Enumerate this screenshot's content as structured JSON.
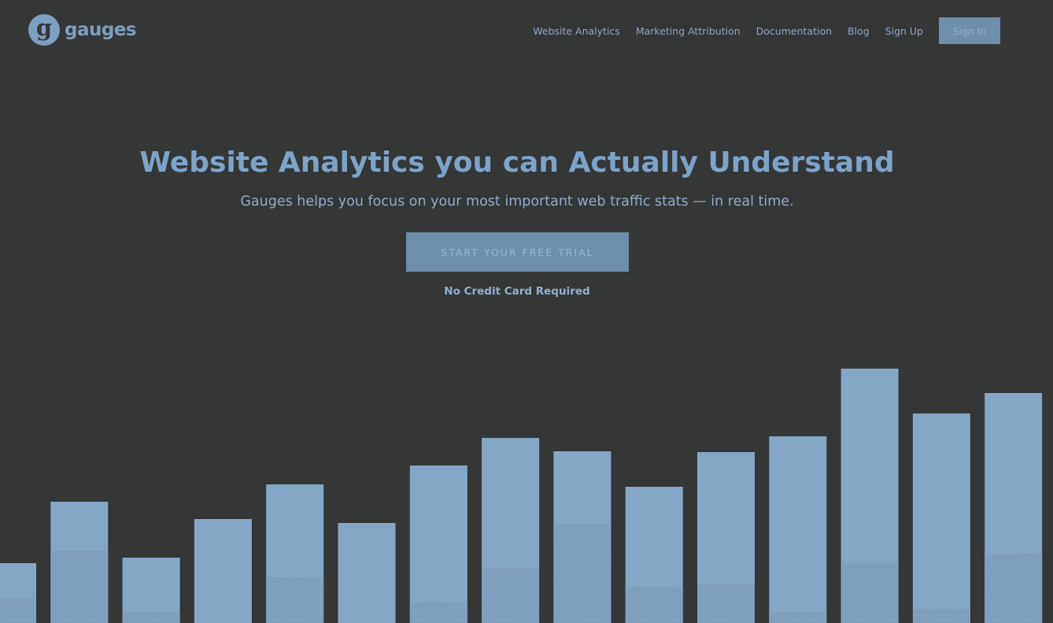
{
  "header": {
    "logo_letter": "g",
    "logo_text": "gauges",
    "nav": [
      {
        "label": "Website Analytics"
      },
      {
        "label": "Marketing Attribution"
      },
      {
        "label": "Documentation"
      },
      {
        "label": "Blog"
      },
      {
        "label": "Sign Up"
      }
    ],
    "signin_label": "Sign In"
  },
  "hero": {
    "title": "Website Analytics you can Actually Understand",
    "subtitle": "Gauges helps you focus on your most important web traffic stats — in real time.",
    "cta_label": "START YOUR FREE TRIAL",
    "note": "No Credit Card Required"
  },
  "colors": {
    "background": "#353636",
    "accent": "#7da3c8",
    "bar": "#86a6c5",
    "bar_lower": "#7d9cb9"
  },
  "chart_data": {
    "type": "bar",
    "series": [
      {
        "values": [
          76,
          154,
          83,
          132,
          176,
          127,
          200,
          235,
          218,
          173,
          217,
          237,
          323,
          266,
          292
        ]
      },
      {
        "values": [
          31,
          91,
          13,
          0,
          57,
          0,
          25,
          69,
          126,
          46,
          49,
          13,
          75,
          18,
          88
        ]
      }
    ]
  }
}
